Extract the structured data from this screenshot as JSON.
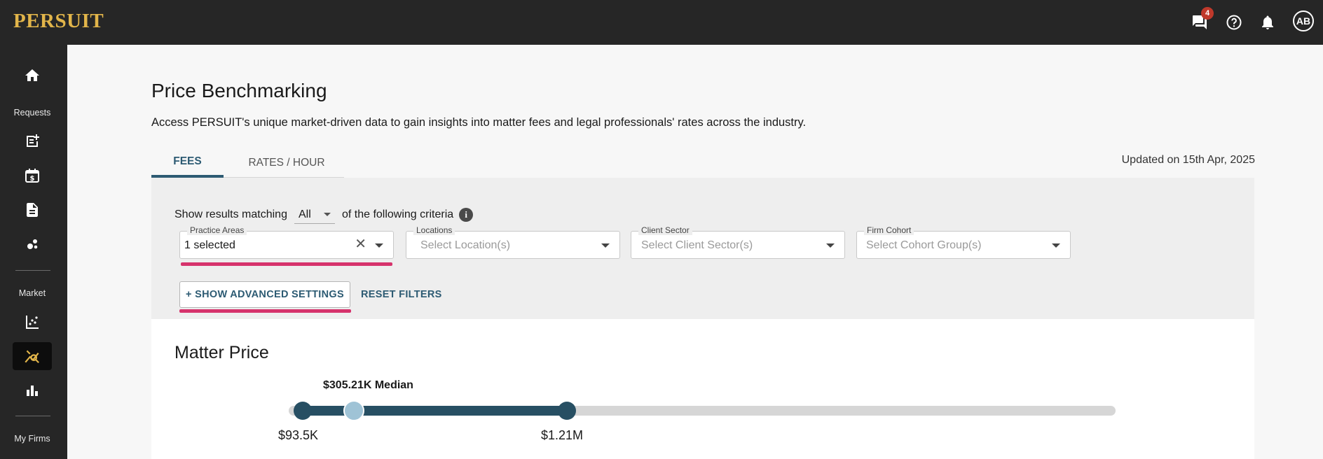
{
  "app": {
    "logo": "PERSUIT",
    "messages_badge": "4",
    "user_initials": "AB"
  },
  "sidebar": {
    "sections": [
      {
        "label": "Requests"
      },
      {
        "label": "Market"
      },
      {
        "label": "My Firms"
      }
    ],
    "icons": [
      "home-icon",
      "request-icon",
      "calendar-dollar-icon",
      "document-icon",
      "bubbles-icon",
      "scatter-chart-icon",
      "price-benchmark-icon",
      "bar-chart-icon"
    ]
  },
  "page": {
    "title": "Price Benchmarking",
    "description": "Access PERSUIT's unique market-driven data to gain insights into matter fees and legal professionals' rates across the industry.",
    "updated": "Updated on 15th Apr, 2025"
  },
  "tabs": [
    {
      "label": "FEES",
      "active": true
    },
    {
      "label": "RATES / HOUR",
      "active": false
    }
  ],
  "filters": {
    "criteria_prefix": "Show results matching",
    "match_value": "All",
    "criteria_suffix": "of the following criteria",
    "fields": [
      {
        "label": "Practice Areas",
        "value": "1 selected",
        "placeholder": ""
      },
      {
        "label": "Locations",
        "value": "",
        "placeholder": "Select Location(s)"
      },
      {
        "label": "Client Sector",
        "value": "",
        "placeholder": "Select Client Sector(s)"
      },
      {
        "label": "Firm Cohort",
        "value": "",
        "placeholder": "Select Cohort Group(s)"
      }
    ],
    "advanced_button": "+ SHOW ADVANCED SETTINGS",
    "reset_button": "RESET FILTERS"
  },
  "matter_price": {
    "title": "Matter Price",
    "median_label": "$305.21K Median",
    "min_label": "$93.5K",
    "max_label": "$1.21M"
  },
  "colors": {
    "accent": "#2d5b73",
    "logo": "#e2b54a",
    "highlight": "#d6336c",
    "median": "#9fc3d6"
  }
}
